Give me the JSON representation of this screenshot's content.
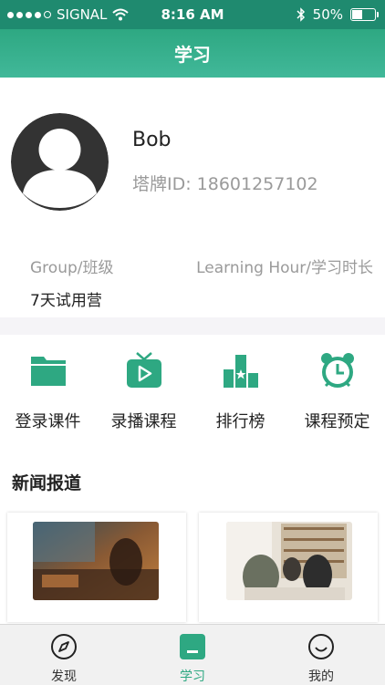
{
  "status_bar": {
    "carrier": "SIGNAL",
    "time": "8:16 AM",
    "battery": "50%",
    "battery_level": 0.5
  },
  "header": {
    "title": "学习"
  },
  "profile": {
    "name": "Bob",
    "id_label": "塔牌ID:",
    "id_value": "18601257102",
    "group_label": "Group/班级",
    "hours_label": "Learning Hour/学习时长",
    "group_value": "7天试用营"
  },
  "features": [
    {
      "label": "登录课件",
      "icon": "folder-icon"
    },
    {
      "label": "录播课程",
      "icon": "tv-play-icon"
    },
    {
      "label": "排行榜",
      "icon": "podium-icon"
    },
    {
      "label": "课程预定",
      "icon": "alarm-clock-icon"
    }
  ],
  "news": {
    "title": "新闻报道"
  },
  "tabbar": {
    "items": [
      {
        "label": "发现",
        "icon": "compass-icon"
      },
      {
        "label": "学习",
        "icon": "book-icon",
        "active": true
      },
      {
        "label": "我的",
        "icon": "smiley-icon"
      }
    ]
  },
  "colors": {
    "brand": "#2ea882",
    "status_bar": "#1f8a6f",
    "divider": "#f5f4f7"
  }
}
